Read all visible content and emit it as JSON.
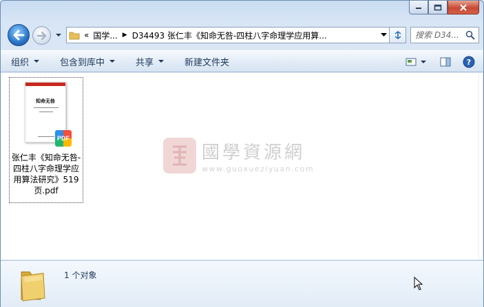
{
  "window": {
    "caption_buttons": [
      "minimize",
      "maximize",
      "close"
    ]
  },
  "nav": {
    "breadcrumb_overflow": "«",
    "breadcrumbs": [
      "国学...",
      "D34493 张仁丰《知命无咎-四柱八字命理学应用算..."
    ],
    "search_placeholder": "搜索 D34..."
  },
  "toolbar": {
    "organize": "组织",
    "include_in_library": "包含到库中",
    "share": "共享",
    "new_folder": "新建文件夹"
  },
  "file": {
    "name": "张仁丰《知命无咎-四柱八字命理学应用算法研究》519页.pdf",
    "thumb_title": "知命无咎",
    "badge": "PDF"
  },
  "watermark": {
    "title": "國學資源網",
    "url": "www.guoxueziyuan.com"
  },
  "status": {
    "count_text": "1 个对象"
  },
  "colors": {
    "accent": "#2b74c9",
    "close_red": "#c74a33",
    "text": "#1e395b"
  }
}
